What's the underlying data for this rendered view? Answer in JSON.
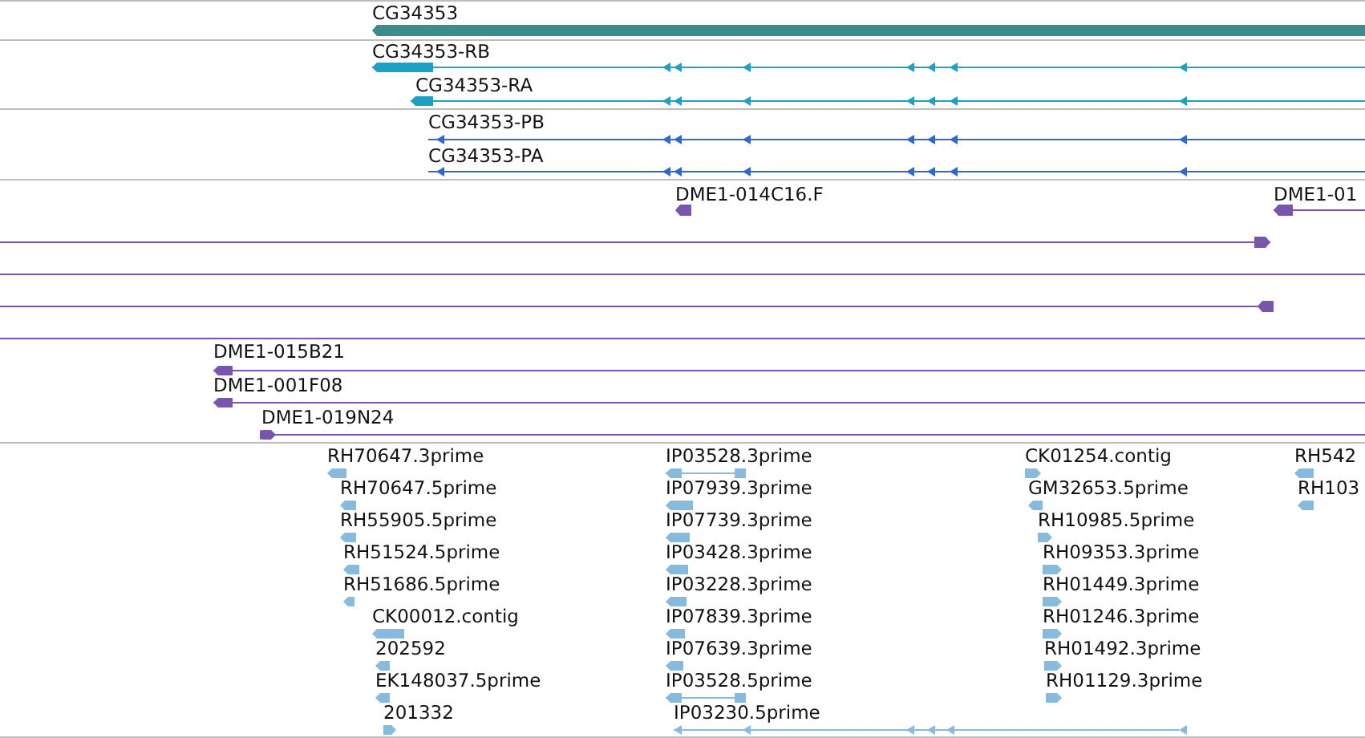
{
  "tracks": [
    {
      "kind": "gene",
      "features": [
        {
          "label": "CG34353",
          "reverse": true
        }
      ]
    },
    {
      "kind": "transcript",
      "features": [
        {
          "label": "CG34353-RB",
          "reverse": true
        },
        {
          "label": "CG34353-RA",
          "reverse": true
        }
      ]
    },
    {
      "kind": "protein",
      "features": [
        {
          "label": "CG34353-PB",
          "reverse": true
        },
        {
          "label": "CG34353-PA",
          "reverse": true
        }
      ]
    },
    {
      "kind": "clone",
      "features": [
        {
          "kind": "read",
          "label": "DME1-014C16.F",
          "reverse": true
        },
        {
          "kind": "read",
          "label": "DME1-01",
          "reverse": true
        },
        {
          "kind": "read",
          "reverse": false
        },
        {
          "kind": "span"
        },
        {
          "kind": "read",
          "reverse": true
        },
        {
          "kind": "span"
        },
        {
          "kind": "read",
          "label": "DME1-015B21",
          "reverse": true
        },
        {
          "kind": "read",
          "label": "DME1-001F08",
          "reverse": true
        },
        {
          "kind": "read",
          "label": "DME1-019N24",
          "reverse": false
        }
      ]
    },
    {
      "kind": "est",
      "features": [
        {
          "label": "RH70647.3prime",
          "reverse": true
        },
        {
          "label": "RH70647.5prime",
          "reverse": true
        },
        {
          "label": "RH55905.5prime",
          "reverse": true
        },
        {
          "label": "RH51524.5prime",
          "reverse": true
        },
        {
          "label": "RH51686.5prime",
          "reverse": true
        },
        {
          "label": "CK00012.contig",
          "reverse": true
        },
        {
          "label": "202592",
          "reverse": true
        },
        {
          "label": "EK148037.5prime",
          "reverse": true
        },
        {
          "label": "201332",
          "reverse": false
        },
        {
          "label": "IP03528.3prime",
          "reverse": true
        },
        {
          "label": "IP07939.3prime",
          "reverse": true
        },
        {
          "label": "IP07739.3prime",
          "reverse": true
        },
        {
          "label": "IP03428.3prime",
          "reverse": true
        },
        {
          "label": "IP03228.3prime",
          "reverse": true
        },
        {
          "label": "IP07839.3prime",
          "reverse": true
        },
        {
          "label": "IP07639.3prime",
          "reverse": true
        },
        {
          "label": "IP03528.5prime",
          "reverse": true
        },
        {
          "label": "IP03230.5prime",
          "reverse": true
        },
        {
          "label": "CK01254.contig",
          "reverse": false
        },
        {
          "label": "GM32653.5prime",
          "reverse": true
        },
        {
          "label": "RH10985.5prime",
          "reverse": false
        },
        {
          "label": "RH09353.3prime",
          "reverse": false
        },
        {
          "label": "RH01449.3prime",
          "reverse": false
        },
        {
          "label": "RH01246.3prime",
          "reverse": false
        },
        {
          "label": "RH01492.3prime",
          "reverse": false
        },
        {
          "label": "RH01129.3prime",
          "reverse": false
        },
        {
          "label": "RH542",
          "reverse": true
        },
        {
          "label": "RH103",
          "reverse": true
        }
      ]
    }
  ]
}
